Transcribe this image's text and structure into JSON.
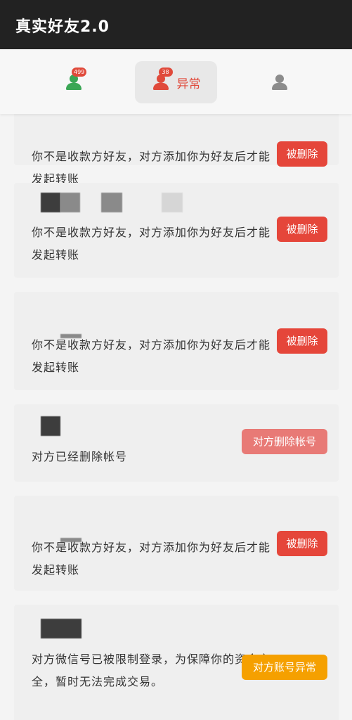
{
  "app": {
    "title": "真实好友2.0"
  },
  "tabs": [
    {
      "name": "friends",
      "badge": "499",
      "label": ""
    },
    {
      "name": "abnormal",
      "badge": "38",
      "label": "异常"
    },
    {
      "name": "profile",
      "badge": "",
      "label": ""
    }
  ],
  "items": [
    {
      "message": "你不是收款方好友，对方添加你为好友后才能发起转账",
      "tag": "被删除"
    },
    {
      "message": "你不是收款方好友，对方添加你为好友后才能发起转账",
      "tag": "被删除"
    },
    {
      "message": "你不是收款方好友，对方添加你为好友后才能发起转账",
      "tag": "被删除"
    },
    {
      "message": "对方已经删除帐号",
      "tag": "对方删除帐号"
    },
    {
      "message": "你不是收款方好友，对方添加你为好友后才能发起转账",
      "tag": "被删除"
    },
    {
      "message": "对方微信号已被限制登录，为保障你的资金安全，暂时无法完成交易。",
      "tag": "对方账号异常"
    }
  ],
  "colors": {
    "appbar": "#222222",
    "delete_tag": "#e5463a",
    "account_deleted_tag": "#e87a76",
    "account_abnormal_tag": "#f5a000",
    "accent": "#e04a3b"
  }
}
